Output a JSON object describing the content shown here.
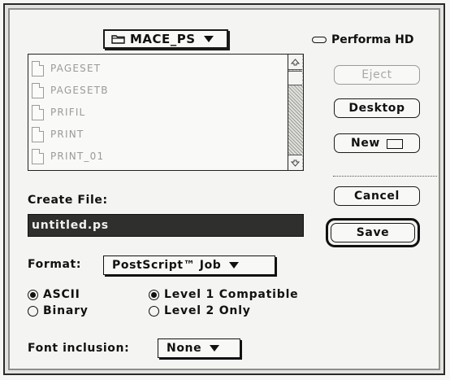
{
  "folder_popup": {
    "label": "MACE_PS"
  },
  "disk": {
    "label": "Performa HD"
  },
  "files": [
    {
      "name": "PAGESET"
    },
    {
      "name": "PAGESETB"
    },
    {
      "name": "PRIFIL"
    },
    {
      "name": "PRINT"
    },
    {
      "name": "PRINT_01"
    }
  ],
  "buttons": {
    "eject": "Eject",
    "desktop": "Desktop",
    "new": "New",
    "cancel": "Cancel",
    "save": "Save"
  },
  "create_file": {
    "label": "Create File:",
    "value": "untitled.ps"
  },
  "format": {
    "label": "Format:",
    "selected": "PostScript™ Job"
  },
  "encoding": {
    "options": [
      {
        "label": "ASCII",
        "selected": true
      },
      {
        "label": "Binary",
        "selected": false
      }
    ]
  },
  "level": {
    "options": [
      {
        "label": "Level 1 Compatible",
        "selected": true
      },
      {
        "label": "Level 2 Only",
        "selected": false
      }
    ]
  },
  "font_inclusion": {
    "label": "Font inclusion:",
    "selected": "None"
  }
}
